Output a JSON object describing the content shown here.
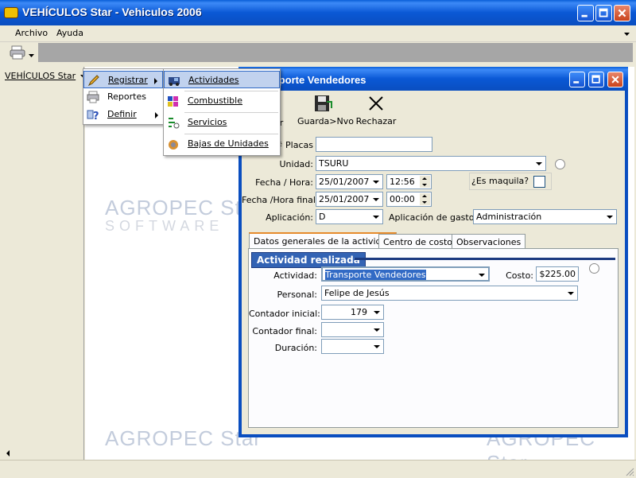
{
  "window": {
    "title": "VEHÍCULOS Star - Vehiculos 2006"
  },
  "menubar": {
    "items": [
      "Archivo",
      "Ayuda"
    ]
  },
  "sidebar": {
    "dropdown_label": "VEHÍCULOS Star"
  },
  "main_menu": {
    "items": [
      {
        "label": "Registrar",
        "icon": "pencil-icon"
      },
      {
        "label": "Reportes",
        "icon": "printer-icon"
      },
      {
        "label": "Definir",
        "icon": "help-icon"
      }
    ]
  },
  "sub_menu": {
    "items": [
      {
        "label": "Actividades",
        "icon": "truck-icon"
      },
      {
        "label": "Combustible",
        "icon": "fuel-icon"
      },
      {
        "label": "Servicios",
        "icon": "wrench-icon"
      },
      {
        "label": "Bajas de Unidades",
        "icon": "lock-icon"
      }
    ]
  },
  "watermark": {
    "brand": "AGROPEC Star",
    "sub": "SOFTWARE"
  },
  "child": {
    "title": "Transporte Vendedores",
    "toolbar": {
      "hidden_label": "r",
      "save_new": "Guarda>Nvo",
      "reject": "Rechazar"
    },
    "form": {
      "placas_label": "# Placas",
      "placas_value": "",
      "unidad_label": "Unidad:",
      "unidad_value": "TSURU",
      "fecha_hora_label": "Fecha / Hora:",
      "fecha_value": "25/01/2007",
      "hora_value": "12:56",
      "es_maquila_label": "¿Es maquila?",
      "fecha_final_label": "Fecha /Hora final:",
      "fecha_final_value": "25/01/2007",
      "hora_final_value": "00:00",
      "aplicacion_label": "Aplicación:",
      "aplicacion_value": "D",
      "aplicacion_gastos_label": "Aplicación de gastos:",
      "aplicacion_gastos_value": "Administración"
    },
    "tabs": [
      "Datos generales de la actividad",
      "Centro de costos",
      "Observaciones"
    ],
    "section_title": "Actividad realizada",
    "activity": {
      "actividad_label": "Actividad:",
      "actividad_value": "Transporte Vendedores",
      "costo_label": "Costo:",
      "costo_value": "$225.00",
      "personal_label": "Personal:",
      "personal_value": "Felipe de Jesús",
      "contador_inicial_label": "Contador inicial:",
      "contador_inicial_value": "179",
      "contador_final_label": "Contador final:",
      "contador_final_value": "",
      "duracion_label": "Duración:",
      "duracion_value": ""
    }
  }
}
